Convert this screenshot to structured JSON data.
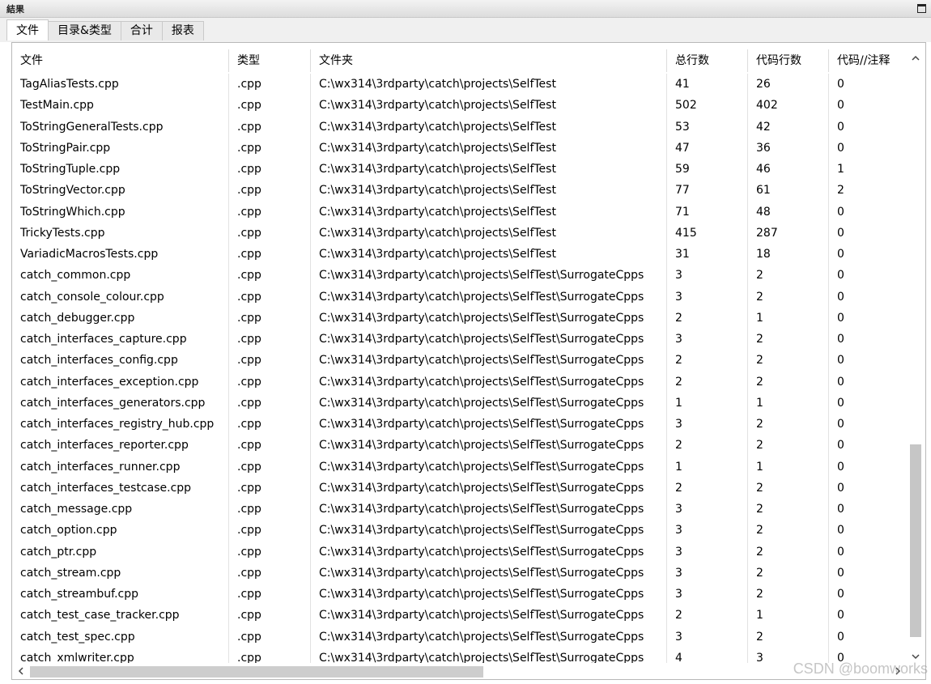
{
  "window": {
    "title": "結果"
  },
  "tabs": [
    {
      "label": "文件",
      "active": true
    },
    {
      "label": "目录&类型",
      "active": false
    },
    {
      "label": "合计",
      "active": false
    },
    {
      "label": "报表",
      "active": false
    }
  ],
  "table": {
    "columns": [
      "文件",
      "类型",
      "文件夹",
      "总行数",
      "代码行数",
      "代码//注释"
    ],
    "rows": [
      [
        "TagAliasTests.cpp",
        ".cpp",
        "C:\\wx314\\3rdparty\\catch\\projects\\SelfTest",
        "41",
        "26",
        "0"
      ],
      [
        "TestMain.cpp",
        ".cpp",
        "C:\\wx314\\3rdparty\\catch\\projects\\SelfTest",
        "502",
        "402",
        "0"
      ],
      [
        "ToStringGeneralTests.cpp",
        ".cpp",
        "C:\\wx314\\3rdparty\\catch\\projects\\SelfTest",
        "53",
        "42",
        "0"
      ],
      [
        "ToStringPair.cpp",
        ".cpp",
        "C:\\wx314\\3rdparty\\catch\\projects\\SelfTest",
        "47",
        "36",
        "0"
      ],
      [
        "ToStringTuple.cpp",
        ".cpp",
        "C:\\wx314\\3rdparty\\catch\\projects\\SelfTest",
        "59",
        "46",
        "1"
      ],
      [
        "ToStringVector.cpp",
        ".cpp",
        "C:\\wx314\\3rdparty\\catch\\projects\\SelfTest",
        "77",
        "61",
        "2"
      ],
      [
        "ToStringWhich.cpp",
        ".cpp",
        "C:\\wx314\\3rdparty\\catch\\projects\\SelfTest",
        "71",
        "48",
        "0"
      ],
      [
        "TrickyTests.cpp",
        ".cpp",
        "C:\\wx314\\3rdparty\\catch\\projects\\SelfTest",
        "415",
        "287",
        "0"
      ],
      [
        "VariadicMacrosTests.cpp",
        ".cpp",
        "C:\\wx314\\3rdparty\\catch\\projects\\SelfTest",
        "31",
        "18",
        "0"
      ],
      [
        "catch_common.cpp",
        ".cpp",
        "C:\\wx314\\3rdparty\\catch\\projects\\SelfTest\\SurrogateCpps",
        "3",
        "2",
        "0"
      ],
      [
        "catch_console_colour.cpp",
        ".cpp",
        "C:\\wx314\\3rdparty\\catch\\projects\\SelfTest\\SurrogateCpps",
        "3",
        "2",
        "0"
      ],
      [
        "catch_debugger.cpp",
        ".cpp",
        "C:\\wx314\\3rdparty\\catch\\projects\\SelfTest\\SurrogateCpps",
        "2",
        "1",
        "0"
      ],
      [
        "catch_interfaces_capture.cpp",
        ".cpp",
        "C:\\wx314\\3rdparty\\catch\\projects\\SelfTest\\SurrogateCpps",
        "3",
        "2",
        "0"
      ],
      [
        "catch_interfaces_config.cpp",
        ".cpp",
        "C:\\wx314\\3rdparty\\catch\\projects\\SelfTest\\SurrogateCpps",
        "2",
        "2",
        "0"
      ],
      [
        "catch_interfaces_exception.cpp",
        ".cpp",
        "C:\\wx314\\3rdparty\\catch\\projects\\SelfTest\\SurrogateCpps",
        "2",
        "2",
        "0"
      ],
      [
        "catch_interfaces_generators.cpp",
        ".cpp",
        "C:\\wx314\\3rdparty\\catch\\projects\\SelfTest\\SurrogateCpps",
        "1",
        "1",
        "0"
      ],
      [
        "catch_interfaces_registry_hub.cpp",
        ".cpp",
        "C:\\wx314\\3rdparty\\catch\\projects\\SelfTest\\SurrogateCpps",
        "3",
        "2",
        "0"
      ],
      [
        "catch_interfaces_reporter.cpp",
        ".cpp",
        "C:\\wx314\\3rdparty\\catch\\projects\\SelfTest\\SurrogateCpps",
        "2",
        "2",
        "0"
      ],
      [
        "catch_interfaces_runner.cpp",
        ".cpp",
        "C:\\wx314\\3rdparty\\catch\\projects\\SelfTest\\SurrogateCpps",
        "1",
        "1",
        "0"
      ],
      [
        "catch_interfaces_testcase.cpp",
        ".cpp",
        "C:\\wx314\\3rdparty\\catch\\projects\\SelfTest\\SurrogateCpps",
        "2",
        "2",
        "0"
      ],
      [
        "catch_message.cpp",
        ".cpp",
        "C:\\wx314\\3rdparty\\catch\\projects\\SelfTest\\SurrogateCpps",
        "3",
        "2",
        "0"
      ],
      [
        "catch_option.cpp",
        ".cpp",
        "C:\\wx314\\3rdparty\\catch\\projects\\SelfTest\\SurrogateCpps",
        "3",
        "2",
        "0"
      ],
      [
        "catch_ptr.cpp",
        ".cpp",
        "C:\\wx314\\3rdparty\\catch\\projects\\SelfTest\\SurrogateCpps",
        "3",
        "2",
        "0"
      ],
      [
        "catch_stream.cpp",
        ".cpp",
        "C:\\wx314\\3rdparty\\catch\\projects\\SelfTest\\SurrogateCpps",
        "3",
        "2",
        "0"
      ],
      [
        "catch_streambuf.cpp",
        ".cpp",
        "C:\\wx314\\3rdparty\\catch\\projects\\SelfTest\\SurrogateCpps",
        "3",
        "2",
        "0"
      ],
      [
        "catch_test_case_tracker.cpp",
        ".cpp",
        "C:\\wx314\\3rdparty\\catch\\projects\\SelfTest\\SurrogateCpps",
        "2",
        "1",
        "0"
      ],
      [
        "catch_test_spec.cpp",
        ".cpp",
        "C:\\wx314\\3rdparty\\catch\\projects\\SelfTest\\SurrogateCpps",
        "3",
        "2",
        "0"
      ],
      [
        "catch_xmlwriter.cpp",
        ".cpp",
        "C:\\wx314\\3rdparty\\catch\\projects\\SelfTest\\SurrogateCpps",
        "4",
        "3",
        "0"
      ]
    ]
  },
  "scrollbars": {
    "vertical": {
      "up_icon": "chevron-up-icon",
      "down_icon": "chevron-down-icon"
    },
    "horizontal": {
      "left_icon": "chevron-left-icon",
      "right_icon": "chevron-right-icon"
    }
  },
  "watermark": "CSDN @boomworks",
  "colors": {
    "header_bg": "#f0f0f0",
    "scroll_thumb": "#c6c6c6"
  }
}
